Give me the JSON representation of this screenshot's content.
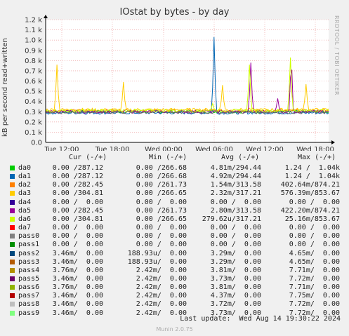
{
  "chart_data": {
    "type": "line",
    "title": "IOstat by bytes - by day",
    "ylabel": "kB per second read+written",
    "watermark": "RRDTOOL / TOBI OETIKER",
    "ylim": [
      0,
      1200
    ],
    "yticks": [
      "0.0",
      "0.1 k",
      "0.2 k",
      "0.3 k",
      "0.4 k",
      "0.5 k",
      "0.6 k",
      "0.7 k",
      "0.8 k",
      "0.9 k",
      "1.0 k",
      "1.1 k",
      "1.2 k"
    ],
    "xticks": [
      "Tue 12:00",
      "Tue 18:00",
      "Wed 00:00",
      "Wed 06:00",
      "Wed 12:00",
      "Wed 18:00"
    ],
    "grid": true,
    "series": [
      {
        "name": "da0",
        "color": "#00cc00",
        "baseline": 300
      },
      {
        "name": "da1",
        "color": "#0066b3",
        "baseline": 290,
        "spikes": [
          [
            0.595,
            1030
          ]
        ]
      },
      {
        "name": "da2",
        "color": "#ff8000",
        "baseline": 310
      },
      {
        "name": "da3",
        "color": "#ffcc00",
        "baseline": 320,
        "spikes": [
          [
            0.04,
            760
          ],
          [
            0.275,
            590
          ],
          [
            0.625,
            560
          ],
          [
            0.92,
            570
          ]
        ]
      },
      {
        "name": "da5",
        "color": "#990099",
        "baseline": 300,
        "spikes": [
          [
            0.725,
            780
          ],
          [
            0.82,
            430
          ],
          [
            0.868,
            860
          ]
        ]
      },
      {
        "name": "da6",
        "color": "#ccff00",
        "baseline": 310,
        "spikes": [
          [
            0.72,
            760
          ],
          [
            0.865,
            830
          ],
          [
            0.59,
            380
          ]
        ]
      },
      {
        "name": "pass",
        "color": "#666666",
        "baseline": 295
      }
    ]
  },
  "legend": {
    "header": {
      "cur": "Cur (-/+)",
      "min": "Min (-/+)",
      "avg": "Avg (-/+)",
      "max": "Max (-/+)"
    },
    "rows": [
      {
        "name": "da0",
        "color": "#00cc00",
        "cur": "0.00 /287.12",
        "min": "0.00 /266.68",
        "avg": "4.81m/294.44",
        "max": "1.24 /  1.04k"
      },
      {
        "name": "da1",
        "color": "#0066b3",
        "cur": "0.00 /287.12",
        "min": "0.00 /266.68",
        "avg": "4.92m/294.44",
        "max": "1.24 /  1.04k"
      },
      {
        "name": "da2",
        "color": "#ff8000",
        "cur": "0.00 /282.45",
        "min": "0.00 /261.73",
        "avg": "1.54m/313.58",
        "max": "402.64m/874.21"
      },
      {
        "name": "da3",
        "color": "#ffcc00",
        "cur": "0.00 /304.81",
        "min": "0.00 /266.65",
        "avg": "2.32m/317.21",
        "max": "576.39m/853.67"
      },
      {
        "name": "da4",
        "color": "#330099",
        "cur": "0.00 /  0.00",
        "min": "0.00 /  0.00",
        "avg": "0.00 /  0.00",
        "max": "0.00 /  0.00"
      },
      {
        "name": "da5",
        "color": "#990099",
        "cur": "0.00 /282.45",
        "min": "0.00 /261.73",
        "avg": "2.80m/313.58",
        "max": "422.20m/874.21"
      },
      {
        "name": "da6",
        "color": "#ccff00",
        "cur": "0.00 /304.81",
        "min": "0.00 /266.65",
        "avg": "279.62u/317.21",
        "max": "25.16m/853.67"
      },
      {
        "name": "da7",
        "color": "#ff0000",
        "cur": "0.00 /  0.00",
        "min": "0.00 /  0.00",
        "avg": "0.00 /  0.00",
        "max": "0.00 /  0.00"
      },
      {
        "name": "pass0",
        "color": "#808080",
        "cur": "0.00 /  0.00",
        "min": "0.00 /  0.00",
        "avg": "0.00 /  0.00",
        "max": "0.00 /  0.00"
      },
      {
        "name": "pass1",
        "color": "#008f00",
        "cur": "0.00 /  0.00",
        "min": "0.00 /  0.00",
        "avg": "0.00 /  0.00",
        "max": "0.00 /  0.00"
      },
      {
        "name": "pass2",
        "color": "#00487d",
        "cur": "3.46m/  0.00",
        "min": "188.93u/  0.00",
        "avg": "3.29m/  0.00",
        "max": "4.65m/  0.00"
      },
      {
        "name": "pass3",
        "color": "#b35a00",
        "cur": "3.46m/  0.00",
        "min": "188.93u/  0.00",
        "avg": "3.29m/  0.00",
        "max": "4.65m/  0.00"
      },
      {
        "name": "pass4",
        "color": "#b38f00",
        "cur": "3.76m/  0.00",
        "min": "2.42m/  0.00",
        "avg": "3.81m/  0.00",
        "max": "7.71m/  0.00"
      },
      {
        "name": "pass5",
        "color": "#6b006b",
        "cur": "3.46m/  0.00",
        "min": "2.42m/  0.00",
        "avg": "3.73m/  0.00",
        "max": "7.72m/  0.00"
      },
      {
        "name": "pass6",
        "color": "#8fb300",
        "cur": "3.76m/  0.00",
        "min": "2.42m/  0.00",
        "avg": "3.81m/  0.00",
        "max": "7.71m/  0.00"
      },
      {
        "name": "pass7",
        "color": "#b30000",
        "cur": "3.46m/  0.00",
        "min": "2.42m/  0.00",
        "avg": "4.37m/  0.00",
        "max": "7.75m/  0.00"
      },
      {
        "name": "pass8",
        "color": "#bebebe",
        "cur": "3.46m/  0.00",
        "min": "2.42m/  0.00",
        "avg": "3.72m/  0.00",
        "max": "7.72m/  0.00"
      },
      {
        "name": "pass9",
        "color": "#80ff80",
        "cur": "3.46m/  0.00",
        "min": "2.42m/  0.00",
        "avg": "3.73m/  0.00",
        "max": "7.72m/  0.00"
      }
    ]
  },
  "footer": {
    "last_update": "Last update:  Wed Aug 14 19:30:22 2024",
    "munin": "Munin 2.0.75"
  }
}
